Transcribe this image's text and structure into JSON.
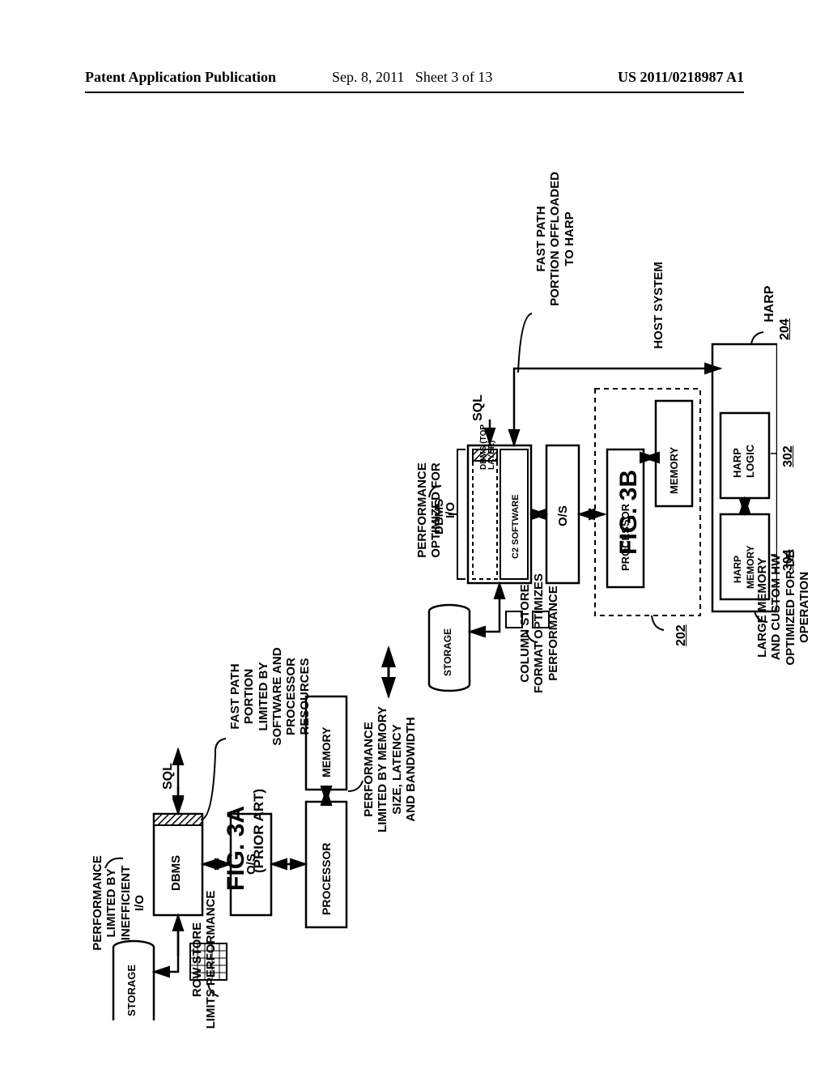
{
  "header": {
    "left": "Patent Application Publication",
    "date": "Sep. 8, 2011",
    "sheet": "Sheet 3 of 13",
    "docnum": "US 2011/0218987 A1"
  },
  "fig_a": {
    "label": "FIG. 3A",
    "sublabel": "(PRIOR ART)",
    "top": "SQL",
    "dbms": "DBMS",
    "os": "O/S",
    "processor": "PROCESSOR",
    "memory": "MEMORY",
    "storage": "STORAGE",
    "note_io": "PERFORMANCE\nLIMITED BY\nINEFFICIENT\nI/O",
    "note_fast": "FAST PATH\nPORTION\nLIMITED BY\nSOFTWARE AND\nPROCESSOR\nRESOURCES",
    "note_mem": "PERFORMANCE\nLIMITED BY MEMORY\nSIZE, LATENCY\nAND BANDWIDTH",
    "note_row": "ROW STORE\nLIMITS PERFORMANCE"
  },
  "fig_b": {
    "label": "FIG. 3B",
    "top": "SQL",
    "dbms": "DBMS",
    "dbms_top": "DBMS (TOP\nLAYER)",
    "c2": "C2 SOFTWARE",
    "os": "O/S",
    "processor": "PROCESSOR",
    "memory": "MEMORY",
    "storage": "STORAGE",
    "host": "HOST SYSTEM",
    "host_ref": "202",
    "harp": "HARP",
    "harp_ref": "204",
    "harp_logic": "HARP\nLOGIC",
    "harp_logic_ref": "302",
    "harp_mem": "HARP\nMEMORY",
    "harp_mem_ref": "304",
    "note_io": "PERFORMANCE\nOPTIMIZED FOR\nI/O",
    "note_fast": "FAST PATH\nPORTION OFFLOADED\nTO HARP",
    "note_col": "COLUMN STORE\nFORMAT OPTIMIZES\nPERFORMANCE",
    "note_large": "LARGE MEMORY\nAND CUSTOM HW\nOPTIMIZED FOR DB\nOPERATION"
  }
}
